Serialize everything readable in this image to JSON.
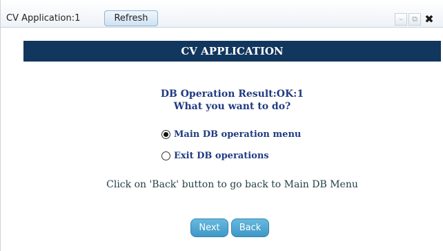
{
  "window": {
    "title": "CV Application:1",
    "refresh_label": "Refresh",
    "controls": {
      "minimize_glyph": "–",
      "popout_glyph": "⧉",
      "close_glyph": "✖"
    }
  },
  "banner": {
    "title": "CV APPLICATION"
  },
  "result": {
    "line1": "DB Operation Result:OK:1",
    "line2": "What you want to do?"
  },
  "options": [
    {
      "label": "Main DB operation menu",
      "selected": true
    },
    {
      "label": "Exit DB operations",
      "selected": false
    }
  ],
  "hint": "Click on 'Back' button to go back to Main DB Menu",
  "buttons": {
    "next_label": "Next",
    "back_label": "Back"
  },
  "colors": {
    "banner_bg": "#11375e",
    "accent_text": "#1f3b82",
    "button_bg": "#4aa3d0"
  },
  "icons": [
    "minimize-icon",
    "popout-icon",
    "close-icon"
  ]
}
